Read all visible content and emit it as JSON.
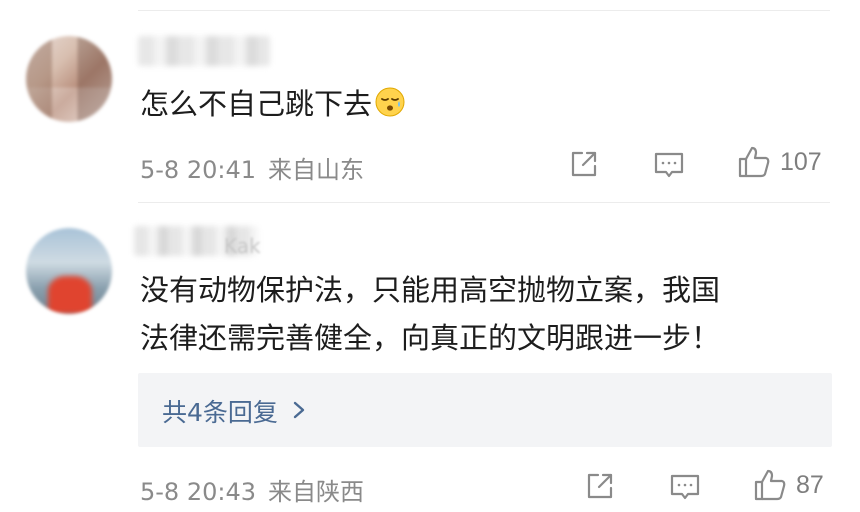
{
  "comments": [
    {
      "text": "怎么不自己跳下去",
      "emoji": "sad-sweat-emoji",
      "date": "5-8 20:41",
      "location": "来自山东",
      "likes": "107"
    },
    {
      "name_fragment": "Kak",
      "text_line1": "没有动物保护法，只能用高空抛物立案，我国",
      "text_line2": "法律还需完善健全，向真正的文明跟进一步！",
      "replies_label": "共4条回复",
      "date": "5-8 20:43",
      "location": "来自陕西",
      "likes": "87"
    }
  ],
  "icons": {
    "share": "share-icon",
    "comment": "comment-icon",
    "like": "like-icon",
    "chevron": "chevron-right-icon"
  },
  "colors": {
    "link": "#4a6a93",
    "meta": "#8a8a8a",
    "reply_box_bg": "#f3f4f6"
  }
}
